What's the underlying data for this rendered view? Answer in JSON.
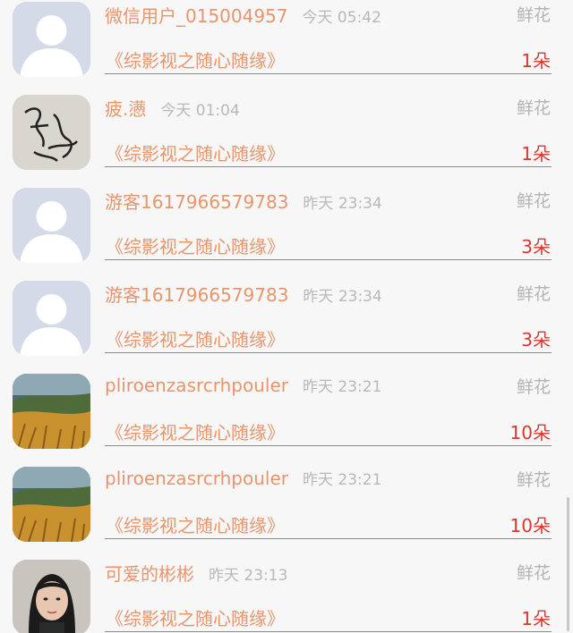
{
  "gifts": [
    {
      "avatar": "default-avatar",
      "name": "微信用户_015004957",
      "time": "今天 05:42",
      "kind": "鲜花",
      "book": "《综影视之随心随缘》",
      "count": "1朵"
    },
    {
      "avatar": "calligraphy-avatar",
      "name": "疲.懑",
      "time": "今天 01:04",
      "kind": "鲜花",
      "book": "《综影视之随心随缘》",
      "count": "1朵"
    },
    {
      "avatar": "default-avatar",
      "name": "游客1617966579783",
      "time": "昨天 23:34",
      "kind": "鲜花",
      "book": "《综影视之随心随缘》",
      "count": "3朵"
    },
    {
      "avatar": "default-avatar",
      "name": "游客1617966579783",
      "time": "昨天 23:34",
      "kind": "鲜花",
      "book": "《综影视之随心随缘》",
      "count": "3朵"
    },
    {
      "avatar": "landscape-avatar",
      "name": "pliroenzasrcrhpouler",
      "time": "昨天 23:21",
      "kind": "鲜花",
      "book": "《综影视之随心随缘》",
      "count": "10朵"
    },
    {
      "avatar": "landscape-avatar",
      "name": "pliroenzasrcrhpouler",
      "time": "昨天 23:21",
      "kind": "鲜花",
      "book": "《综影视之随心随缘》",
      "count": "10朵"
    },
    {
      "avatar": "portrait-avatar",
      "name": "可爱的彬彬",
      "time": "昨天 23:13",
      "kind": "鲜花",
      "book": "《综影视之随心随缘》",
      "count": "1朵"
    }
  ],
  "colors": {
    "name": "#e8956b",
    "count": "#d63a2e",
    "muted": "#b8b8b8",
    "background": "#f7f7f7"
  }
}
